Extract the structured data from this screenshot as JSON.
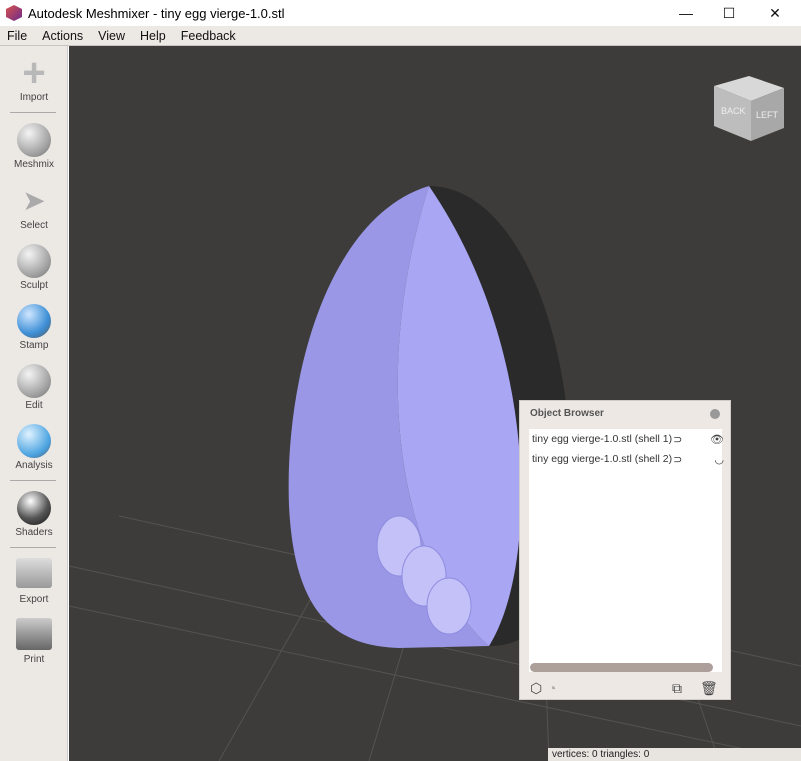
{
  "window": {
    "title": "Autodesk Meshmixer - tiny egg vierge-1.0.stl",
    "minimize": "—",
    "maximize": "☐",
    "close": "✕"
  },
  "menu": [
    "File",
    "Actions",
    "View",
    "Help",
    "Feedback"
  ],
  "tools": [
    {
      "label": "Import",
      "icon": "plus-icon"
    },
    {
      "label": "Meshmix",
      "icon": "meshmix-icon"
    },
    {
      "label": "Select",
      "icon": "arrow-icon"
    },
    {
      "label": "Sculpt",
      "icon": "brush-icon"
    },
    {
      "label": "Stamp",
      "icon": "stamp-icon"
    },
    {
      "label": "Edit",
      "icon": "edit-icon"
    },
    {
      "label": "Analysis",
      "icon": "analysis-icon"
    },
    {
      "label": "Shaders",
      "icon": "sphere-icon"
    },
    {
      "label": "Export",
      "icon": "export-icon"
    },
    {
      "label": "Print",
      "icon": "printer-icon"
    }
  ],
  "viewcube": {
    "back": "BACK",
    "left": "LEFT"
  },
  "object_browser": {
    "title": "Object Browser",
    "items": [
      {
        "name": "tiny egg vierge-1.0.stl (shell 1)",
        "visible": true
      },
      {
        "name": "tiny egg vierge-1.0.stl (shell 2)",
        "visible": false
      }
    ]
  },
  "status": "vertices: 0 triangles: 0",
  "colors": {
    "viewport": "#3d3c3a",
    "mesh_selected": "#9f9cf0",
    "panel": "#ede8e4"
  }
}
